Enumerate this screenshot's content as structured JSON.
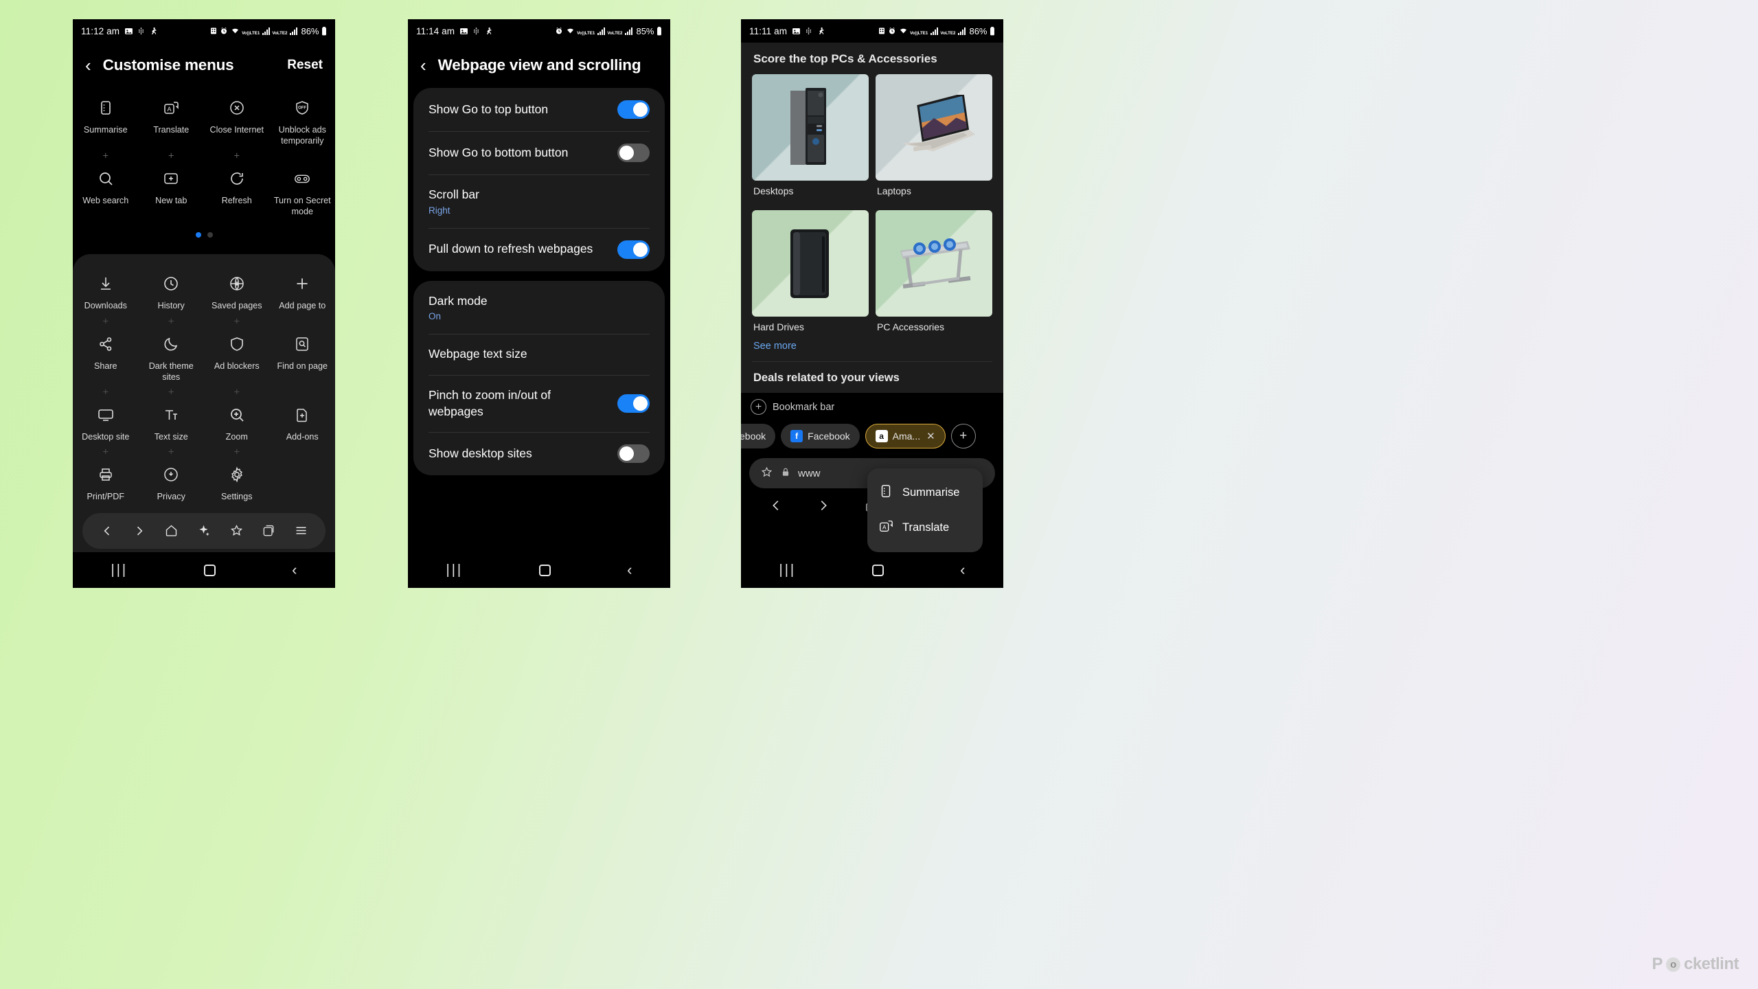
{
  "background": {
    "left_color": "#cdf2ac",
    "right_color": "#f2ecf7"
  },
  "accent": {
    "blue": "#1a82f7",
    "link_blue": "#7aa5e8",
    "tab_gold": "#d8a93a"
  },
  "panel1": {
    "status": {
      "time": "11:12 am",
      "battery": "86%",
      "lte1": "VoLTE1",
      "lte2": "VoLTE2"
    },
    "header": {
      "back": "‹",
      "title": "Customise menus",
      "action": "Reset"
    },
    "top_items": [
      {
        "label": "Summarise",
        "icon": "summarise-icon"
      },
      {
        "label": "Translate",
        "icon": "translate-icon"
      },
      {
        "label": "Close Internet",
        "icon": "close-circle-icon"
      },
      {
        "label": "Unblock ads temporarily",
        "icon": "shield-off-icon"
      },
      {
        "label": "Web search",
        "icon": "search-icon"
      },
      {
        "label": "New tab",
        "icon": "new-tab-icon"
      },
      {
        "label": "Refresh",
        "icon": "refresh-icon"
      },
      {
        "label": "Turn on Secret mode",
        "icon": "secret-mode-icon"
      }
    ],
    "pager": {
      "count": 2,
      "active": 0
    },
    "sheet_items": [
      {
        "label": "Downloads",
        "icon": "download-icon"
      },
      {
        "label": "History",
        "icon": "clock-icon"
      },
      {
        "label": "Saved pages",
        "icon": "globe-download-icon"
      },
      {
        "label": "Add page to",
        "icon": "plus-icon"
      },
      {
        "label": "Share",
        "icon": "share-icon"
      },
      {
        "label": "Dark theme sites",
        "icon": "moon-icon"
      },
      {
        "label": "Ad blockers",
        "icon": "shield-icon"
      },
      {
        "label": "Find on page",
        "icon": "find-on-page-icon"
      },
      {
        "label": "Desktop site",
        "icon": "desktop-icon"
      },
      {
        "label": "Text size",
        "icon": "text-size-icon"
      },
      {
        "label": "Zoom",
        "icon": "zoom-icon"
      },
      {
        "label": "Add-ons",
        "icon": "addons-icon"
      },
      {
        "label": "Print/PDF",
        "icon": "print-icon"
      },
      {
        "label": "Privacy",
        "icon": "privacy-icon"
      },
      {
        "label": "Settings",
        "icon": "gear-icon"
      },
      {
        "label": "",
        "icon": ""
      }
    ],
    "navpill": [
      "back-icon",
      "forward-icon",
      "home-icon",
      "ai-sparkle-icon",
      "bookmark-star-icon",
      "tabs-icon",
      "menu-icon"
    ]
  },
  "panel2": {
    "status": {
      "time": "11:14 am",
      "battery": "85%"
    },
    "header": {
      "back": "‹",
      "title": "Webpage view and scrolling"
    },
    "group1": [
      {
        "title": "Show Go to top button",
        "value": "",
        "toggle": "on"
      },
      {
        "title": "Show Go to bottom button",
        "value": "",
        "toggle": "off"
      },
      {
        "title": "Scroll bar",
        "value": "Right",
        "toggle": "none"
      },
      {
        "title": "Pull down to refresh webpages",
        "value": "",
        "toggle": "on"
      }
    ],
    "group2": [
      {
        "title": "Dark mode",
        "value": "On",
        "toggle": "none"
      },
      {
        "title": "Webpage text size",
        "value": "",
        "toggle": "none"
      },
      {
        "title": "Pinch to zoom in/out of webpages",
        "value": "",
        "toggle": "on"
      },
      {
        "title": "Show desktop sites",
        "value": "",
        "toggle": "off"
      }
    ]
  },
  "panel3": {
    "status": {
      "time": "11:11 am",
      "battery": "86%"
    },
    "page": {
      "heading": "Score the top PCs & Accessories",
      "products": [
        {
          "caption": "Desktops",
          "bg1": "#a8bfc0",
          "bg2": "#c4d4d3",
          "art": "desktop-tower-photo"
        },
        {
          "caption": "Laptops",
          "bg1": "#c3cdce",
          "bg2": "#d5dddd",
          "art": "laptop-photo"
        },
        {
          "caption": "Hard Drives",
          "bg1": "#b9d5b5",
          "bg2": "#cee3c9",
          "art": "hard-drive-photo"
        },
        {
          "caption": "PC Accessories",
          "bg1": "#b8d6b8",
          "bg2": "#d2e6d0",
          "art": "laptop-stand-photo"
        }
      ],
      "see_more": "See more",
      "heading2": "Deals related to your views"
    },
    "bookmark_bar": {
      "label": "Bookmark bar"
    },
    "tabs": [
      {
        "label": "ebook",
        "favicon": "none",
        "active": false
      },
      {
        "label": "Facebook",
        "favicon": "facebook",
        "active": false
      },
      {
        "label": "Ama...",
        "favicon": "amazon",
        "active": true
      }
    ],
    "tab_add": "+",
    "urlbar": {
      "star": "bookmark-star-icon",
      "lock": "lock-icon",
      "text": "www"
    },
    "nav": [
      "back-icon",
      "forward-icon",
      "home-icon",
      "tabs-icon",
      "menu-icon"
    ],
    "context_menu": [
      {
        "label": "Summarise",
        "icon": "summarise-icon"
      },
      {
        "label": "Translate",
        "icon": "translate-icon"
      }
    ]
  },
  "watermark": {
    "pre": "P",
    "post": "cketlint"
  }
}
